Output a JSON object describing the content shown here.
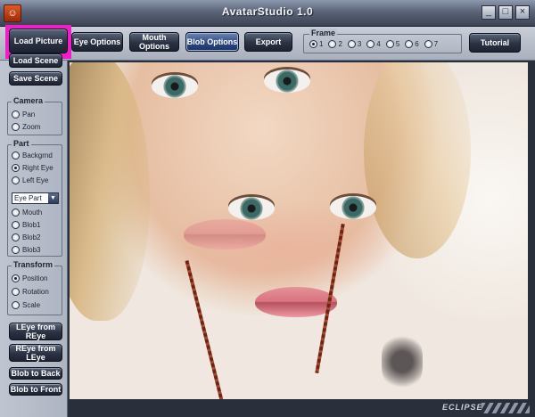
{
  "window": {
    "title": "AvatarStudio 1.0",
    "buttons": [
      "_",
      "□",
      "×"
    ]
  },
  "toolbar": {
    "load_picture": "Load Picture",
    "eye_options": "Eye Options",
    "mouth_options": "Mouth Options",
    "blob_options": "Blob Options",
    "export": "Export",
    "tutorial": "Tutorial"
  },
  "frame": {
    "label": "Frame",
    "options": [
      "1",
      "2",
      "3",
      "4",
      "5",
      "6",
      "7"
    ],
    "selected": "1"
  },
  "left": {
    "load_scene": "Load Scene",
    "save_scene": "Save Scene",
    "camera": {
      "label": "Camera",
      "options": [
        "Pan",
        "Zoom"
      ]
    },
    "part": {
      "label": "Part",
      "options": [
        "Backgrnd",
        "Right Eye",
        "Left Eye"
      ],
      "selected": "Right Eye",
      "dropdown": "Eye Part",
      "options2": [
        "Mouth",
        "Blob1",
        "Blob2",
        "Blob3"
      ]
    },
    "transform": {
      "label": "Transform",
      "options": [
        "Position",
        "Rotation",
        "Scale"
      ],
      "selected": "Position"
    },
    "leye_from_reye": "LEye from REye",
    "reye_from_leye": "REye from LEye",
    "blob_to_back": "Blob to Back",
    "blob_to_front": "Blob to Front"
  },
  "footer": {
    "logo": "ECLIPSE"
  },
  "colors": {
    "highlight": "#f01ec8",
    "active_button": "#2d4a86"
  }
}
